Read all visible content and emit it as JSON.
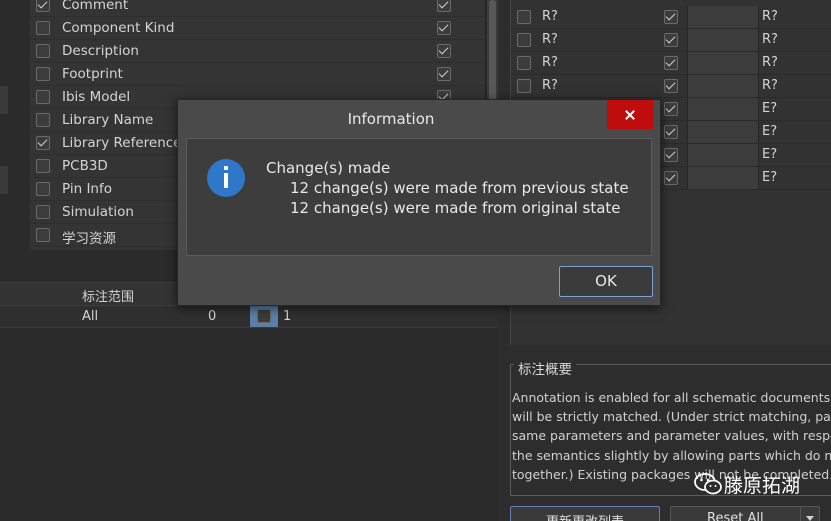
{
  "parameters": [
    {
      "label": "Comment",
      "checked": true,
      "right_checked": true
    },
    {
      "label": "Component Kind",
      "checked": false,
      "right_checked": true
    },
    {
      "label": "Description",
      "checked": false,
      "right_checked": true
    },
    {
      "label": "Footprint",
      "checked": false,
      "right_checked": true
    },
    {
      "label": "Ibis Model",
      "checked": false,
      "right_checked": true
    },
    {
      "label": "Library Name",
      "checked": false,
      "right_checked": false
    },
    {
      "label": "Library Reference",
      "checked": true,
      "right_checked": false
    },
    {
      "label": "PCB3D",
      "checked": false,
      "right_checked": false
    },
    {
      "label": "Pin Info",
      "checked": false,
      "right_checked": false
    },
    {
      "label": "Simulation",
      "checked": false,
      "right_checked": false
    },
    {
      "label": "学习资源",
      "checked": false,
      "right_checked": false
    }
  ],
  "range_table": {
    "header": "标注范围",
    "row": {
      "scope": "All",
      "start": "0",
      "end": "1"
    }
  },
  "designators": [
    {
      "current": "R?",
      "proposed": "R?"
    },
    {
      "current": "R?",
      "proposed": "R?"
    },
    {
      "current": "R?",
      "proposed": "R?"
    },
    {
      "current": "R?",
      "proposed": "R?"
    },
    {
      "current": "",
      "proposed": "E?"
    },
    {
      "current": "",
      "proposed": "E?"
    },
    {
      "current": "",
      "proposed": "E?"
    },
    {
      "current": "",
      "proposed": "E?"
    }
  ],
  "summary": {
    "title": "标注概要",
    "lines": [
      "Annotation is enabled for all schematic documents. P",
      "will be strictly matched. (Under strict matching, parts",
      "same parameters and parameter values, with respect",
      "the semantics slightly by allowing parts which do not",
      "together.) Existing packages will not be completed. A"
    ]
  },
  "buttons": {
    "update": "更新更改列表",
    "reset": "Reset All"
  },
  "watermark": "滕原拓湖",
  "dialog": {
    "title": "Information",
    "heading": "Change(s) made",
    "line1": "12 change(s) were made from previous state",
    "line2": "12 change(s) were made from original state",
    "ok": "OK",
    "icon": "info-icon"
  },
  "colors": {
    "close_button": "#bf0c0c",
    "info_icon": "#2f78c9",
    "accent_border": "#7aa2d6"
  }
}
